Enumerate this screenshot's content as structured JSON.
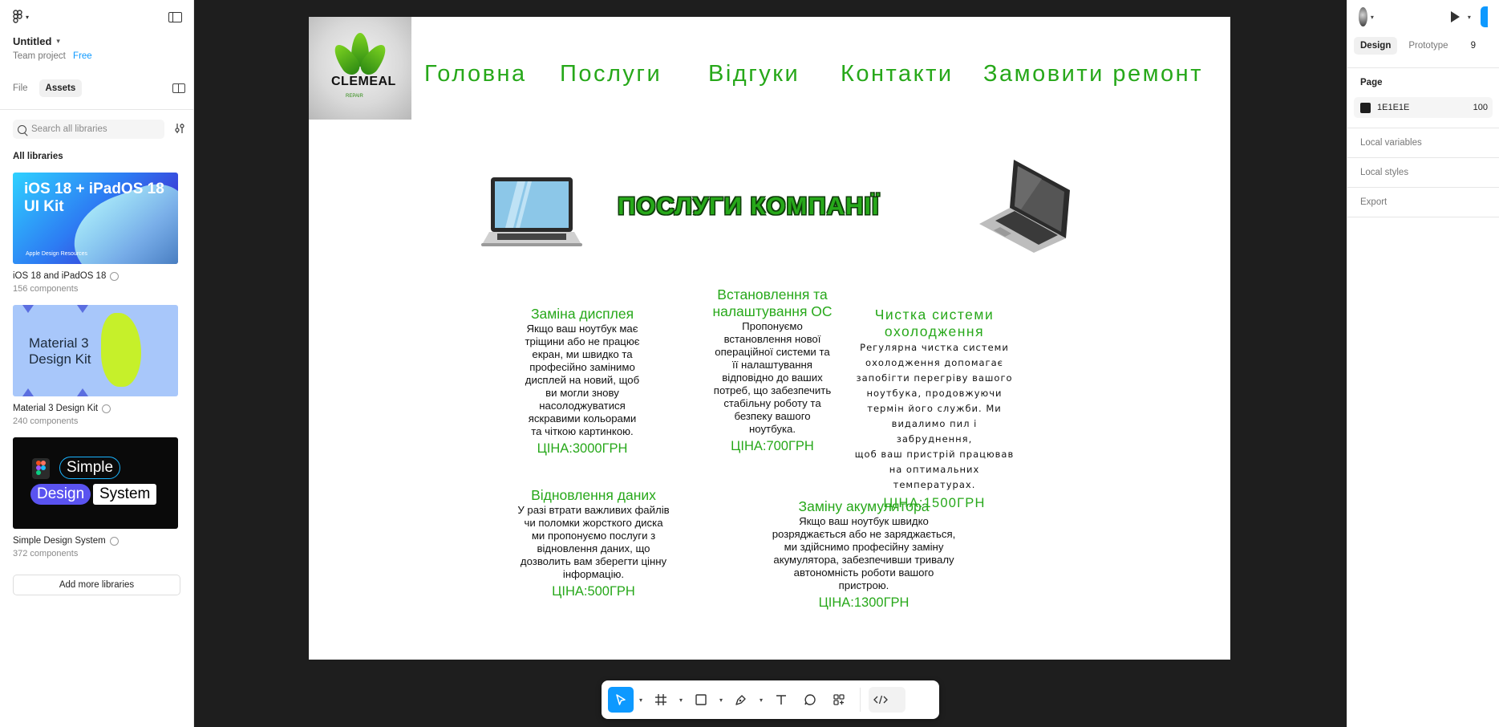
{
  "app": {
    "file_name": "Untitled",
    "team": "Team project",
    "plan": "Free"
  },
  "left_panel": {
    "tabs": [
      "File",
      "Assets"
    ],
    "active_tab": "Assets",
    "search_placeholder": "Search all libraries",
    "section_title": "All libraries",
    "libraries": [
      {
        "name": "iOS 18 and iPadOS 18",
        "count": "156 components",
        "thumb_title": "iOS 18 + iPadOS 18 UI Kit",
        "thumb_sub": "Apple Design Resources"
      },
      {
        "name": "Material 3 Design Kit",
        "count": "240 components",
        "thumb_title": "Material 3 Design Kit"
      },
      {
        "name": "Simple Design System",
        "count": "372 components",
        "thumb_words": [
          "Simple",
          "Design",
          "System"
        ]
      }
    ],
    "add_button": "Add more libraries"
  },
  "canvas": {
    "background": "#1e1e1e",
    "site": {
      "logo_text": "CLEMEAL",
      "logo_sub": "REPAIR",
      "nav": [
        "Головна",
        "Послуги",
        "Відгуки",
        "Контакти",
        "Замовити ремонт"
      ],
      "hero_title": "ПОСЛУГИ КОМПАНІЇ",
      "accent": "#27a81a",
      "services": [
        {
          "title": "Заміна дисплея",
          "desc": [
            "Якщо ваш ноутбук має",
            "тріщини або не працює",
            "екран, ми швидко та",
            "професійно замінимо",
            "дисплей на новий, щоб",
            "ви могли знову",
            "насолоджуватися",
            "яскравими кольорами",
            "та чіткою картинкою."
          ],
          "price": "ЦІНА:3000ГРН"
        },
        {
          "title": [
            "Встановлення та",
            "налаштування ОС"
          ],
          "desc": [
            "Пропонуємо",
            "встановлення нової",
            "операційної системи та",
            "її налаштування",
            "відповідно до ваших",
            "потреб, що забезпечить",
            "стабільну роботу та",
            "безпеку вашого",
            "ноутбука."
          ],
          "price": "ЦІНА:700ГРН"
        },
        {
          "title": [
            "Чистка системи",
            "охолодження"
          ],
          "desc": [
            "Регулярна чистка системи",
            "охолодження допомагає",
            "запобігти перегріву вашого",
            "ноутбука, продовжуючи",
            "термін його служби. Ми",
            "видалимо пил і забруднення,",
            "щоб ваш пристрій працював",
            "на оптимальних",
            "температурах."
          ],
          "price": "ЦІНА:1500ГРН"
        },
        {
          "title": "Відновлення даних",
          "desc": [
            "У разі втрати важливих файлів",
            "чи поломки жорсткого диска",
            "ми пропонуємо послуги з",
            "відновлення даних, що",
            "дозволить вам зберегти цінну",
            "інформацію."
          ],
          "price": "ЦІНА:500ГРН"
        },
        {
          "title": "Заміну акумулятора",
          "desc": [
            "Якщо ваш ноутбук швидко",
            "розряджається або не заряджається,",
            "ми здійснимо професійну заміну",
            "акумулятора, забезпечивши тривалу",
            "автономність роботи вашого",
            "пристрою."
          ],
          "price": "ЦІНА:1300ГРН"
        }
      ]
    }
  },
  "toolbar": {
    "tools": [
      "move-tool",
      "frame-tool",
      "rectangle-tool",
      "pen-tool",
      "text-tool",
      "comment-tool",
      "actions-tool",
      "dev-mode-toggle"
    ],
    "active": "move-tool"
  },
  "right_panel": {
    "tabs": [
      "Design",
      "Prototype"
    ],
    "active_tab": "Design",
    "zoom_partial": "9",
    "page_label": "Page",
    "page_color": "1E1E1E",
    "page_opacity": "100",
    "sections": [
      "Local variables",
      "Local styles",
      "Export"
    ]
  }
}
